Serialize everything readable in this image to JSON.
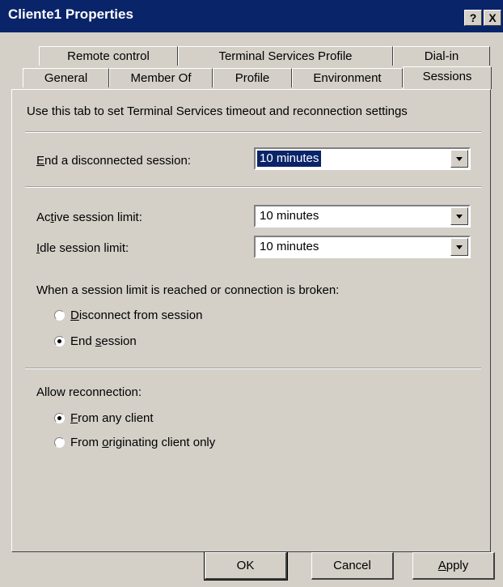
{
  "window": {
    "title": "Cliente1 Properties",
    "help_label": "?",
    "close_label": "X"
  },
  "tabs": {
    "row_back": [
      "Remote control",
      "Terminal Services Profile",
      "Dial-in"
    ],
    "row_front": [
      "General",
      "Member Of",
      "Profile",
      "Environment",
      "Sessions"
    ],
    "active": "Sessions"
  },
  "panel": {
    "description": "Use this tab to set Terminal Services timeout and reconnection settings",
    "end_disconnected": {
      "label_u": "E",
      "label_rest": "nd a disconnected session:",
      "value": "10 minutes"
    },
    "active_limit": {
      "label_pre": "Ac",
      "label_u": "t",
      "label_rest": "ive session limit:",
      "value": "10 minutes"
    },
    "idle_limit": {
      "label_u": "I",
      "label_rest": "dle session limit:",
      "value": "10 minutes"
    },
    "limit_reached": {
      "heading": "When a session limit is reached or connection is broken:",
      "options": [
        {
          "pre": "",
          "u": "D",
          "rest": "isconnect from session",
          "checked": false
        },
        {
          "pre": "End ",
          "u": "s",
          "rest": "ession",
          "checked": true
        }
      ]
    },
    "reconnection": {
      "heading": "Allow reconnection:",
      "options": [
        {
          "pre": "",
          "u": "F",
          "rest": "rom any client",
          "checked": true
        },
        {
          "pre": "From ",
          "u": "o",
          "rest": "riginating client only",
          "checked": false
        }
      ]
    }
  },
  "buttons": {
    "ok": "OK",
    "cancel": "Cancel",
    "apply_u": "A",
    "apply_rest": "pply"
  },
  "colors": {
    "title_bar": "#0a246a",
    "dialog_face": "#d4d0c8",
    "selection": "#0a246a"
  }
}
